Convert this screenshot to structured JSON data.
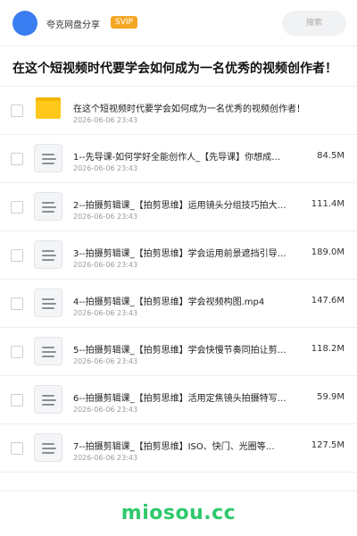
{
  "header": {
    "app_name": "夸克网盘分享",
    "badge": "SVIP",
    "search_placeholder": "搜索",
    "accent_color": "#3a7df0",
    "badge_color": "#f5a623"
  },
  "folder": {
    "title": "在这个短视频时代要学会如何成为一名优秀的视频创作者！"
  },
  "files": [
    {
      "icon": "folder-icon",
      "name": "在这个短视频时代要学会如何成为一名优秀的视频创作者！",
      "date": "2026-06-06 23:43",
      "size": ""
    },
    {
      "icon": "file-icon",
      "name": "1--先导课-如何学好全能创作人_【先导课】你想成…",
      "date": "2026-06-06 23:43",
      "size": "84.5M"
    },
    {
      "icon": "file-icon",
      "name": "2--拍摄剪辑课_【拍剪思维】运用镜头分组技巧拍大…",
      "date": "2026-06-06 23:43",
      "size": "111.4M"
    },
    {
      "icon": "file-icon",
      "name": "3--拍摄剪辑课_【拍剪思维】学会运用前景遮挡引导…",
      "date": "2026-06-06 23:43",
      "size": "189.0M"
    },
    {
      "icon": "file-icon",
      "name": "4--拍摄剪辑课_【拍剪思维】学会视频构图.mp4",
      "date": "2026-06-06 23:43",
      "size": "147.6M"
    },
    {
      "icon": "file-icon",
      "name": "5--拍摄剪辑课_【拍剪思维】学会快慢节奏同拍让剪…",
      "date": "2026-06-06 23:43",
      "size": "118.2M"
    },
    {
      "icon": "file-icon",
      "name": "6--拍摄剪辑课_【拍剪思维】活用定焦镜头拍摄特写…",
      "date": "2026-06-06 23:43",
      "size": "59.9M"
    },
    {
      "icon": "file-icon",
      "name": "7--拍摄剪辑课_【拍剪思维】ISO、快门、光圈等…",
      "date": "2026-06-06 23:43",
      "size": "127.5M"
    }
  ],
  "watermark": {
    "text": "miosou.cc",
    "color": "#2ec96b"
  }
}
